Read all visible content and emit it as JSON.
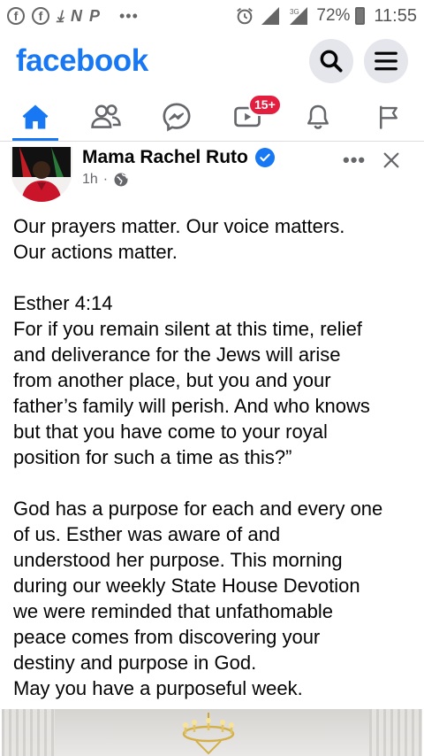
{
  "status_bar": {
    "battery_percent": "72%",
    "time": "11:55",
    "network": "3G",
    "left_icons": [
      "facebook-icon",
      "facebook-icon",
      "download-icon",
      "n-icon",
      "p-icon",
      "more-dots"
    ]
  },
  "header": {
    "logo": "facebook",
    "brand_color": "#1877f2"
  },
  "nav": {
    "items": [
      {
        "name": "home",
        "icon": "home-icon",
        "active": true
      },
      {
        "name": "friends",
        "icon": "friends-icon",
        "active": false
      },
      {
        "name": "messenger",
        "icon": "messenger-icon",
        "active": false
      },
      {
        "name": "watch",
        "icon": "video-icon",
        "active": false,
        "badge": "15+"
      },
      {
        "name": "notifications",
        "icon": "bell-icon",
        "active": false
      },
      {
        "name": "pages",
        "icon": "flag-icon",
        "active": false
      }
    ]
  },
  "post": {
    "author": "Mama Rachel Ruto",
    "verified": true,
    "time": "1h",
    "separator": "·",
    "audience_icon": "globe-icon",
    "lines": [
      "Our prayers matter. Our voice matters.",
      "Our actions matter.",
      "",
      "Esther 4:14",
      "For if you remain silent at this time, relief",
      "and deliverance for the Jews will arise",
      "from another place, but you and your",
      "father’s family will perish. And who knows",
      "but that you have come to your royal",
      "position for such a time as this?”",
      "",
      "God has a purpose for each and every one",
      "of us. Esther was aware of and",
      "understood her purpose. This morning",
      "during our weekly State House Devotion",
      "we were reminded that unfathomable",
      "peace comes from discovering your",
      "destiny and purpose in God.",
      "May you have a purposeful week."
    ]
  }
}
